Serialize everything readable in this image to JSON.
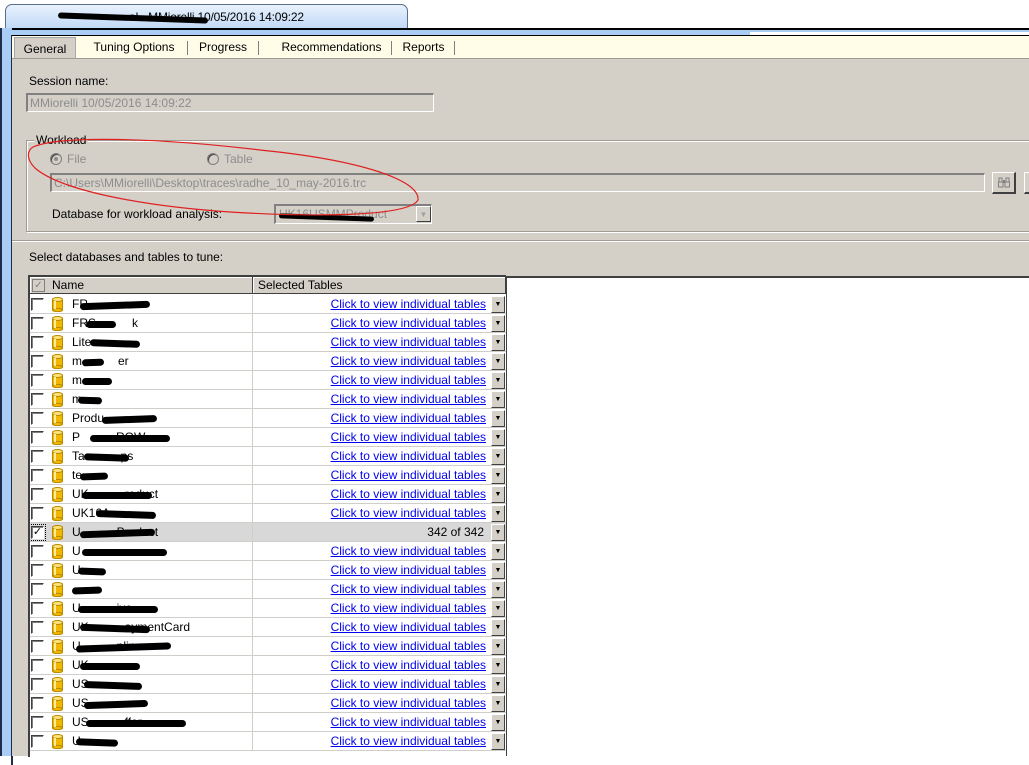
{
  "document_tab": {
    "title_visible": "s...local - MMiorelli 10/05/2016 14:09:22",
    "title_suffix": "al - MMiorelli 10/05/2016 14:09:22"
  },
  "subtabs": [
    {
      "label": "General",
      "active": true
    },
    {
      "label": "Tuning Options",
      "active": false
    },
    {
      "label": "Progress",
      "active": false
    },
    {
      "label": "Recommendations",
      "active": false
    },
    {
      "label": "Reports",
      "active": false
    }
  ],
  "session": {
    "label": "Session name:",
    "value": "MMiorelli 10/05/2016 14:09:22"
  },
  "workload": {
    "group_title": "Workload",
    "radio_file": "File",
    "radio_table": "Table",
    "selected": "File",
    "file_path": "C:\\Users\\MMiorelli\\Desktop\\traces\\radhe_10_may-2016.trc",
    "browse_icon": "binoculars-icon",
    "db_label": "Database for workload analysis:",
    "db_value": "UK16USMMProduct"
  },
  "databases": {
    "label": "Select databases and tables to tune:",
    "columns": [
      "Name",
      "Selected Tables"
    ],
    "link_text": "Click to view individual tables",
    "rows": [
      {
        "name": "FR",
        "checked": false,
        "selected_tables": null
      },
      {
        "name": "FRS...k",
        "checked": false,
        "selected_tables": null
      },
      {
        "name": "Lite",
        "checked": false,
        "selected_tables": null
      },
      {
        "name": "m...er",
        "checked": false,
        "selected_tables": null
      },
      {
        "name": "m",
        "checked": false,
        "selected_tables": null
      },
      {
        "name": "m",
        "checked": false,
        "selected_tables": null
      },
      {
        "name": "Produ",
        "checked": false,
        "selected_tables": null
      },
      {
        "name": "P...ROW",
        "checked": false,
        "selected_tables": null
      },
      {
        "name": "Ta...ps",
        "checked": false,
        "selected_tables": null
      },
      {
        "name": "te",
        "checked": false,
        "selected_tables": null
      },
      {
        "name": "UK...roduct",
        "checked": false,
        "selected_tables": null
      },
      {
        "name": "UK16A",
        "checked": false,
        "selected_tables": null
      },
      {
        "name": "U...Product",
        "checked": true,
        "selected_tables": "342 of 342"
      },
      {
        "name": "U",
        "checked": false,
        "selected_tables": null
      },
      {
        "name": "U",
        "checked": false,
        "selected_tables": null
      },
      {
        "name": "",
        "checked": false,
        "selected_tables": null
      },
      {
        "name": "U...ive",
        "checked": false,
        "selected_tables": null
      },
      {
        "name": "UK...aymentCard",
        "checked": false,
        "selected_tables": null
      },
      {
        "name": "U...nline",
        "checked": false,
        "selected_tables": null
      },
      {
        "name": "UK",
        "checked": false,
        "selected_tables": null
      },
      {
        "name": "US",
        "checked": false,
        "selected_tables": null
      },
      {
        "name": "US",
        "checked": false,
        "selected_tables": null
      },
      {
        "name": "US...ffer",
        "checked": false,
        "selected_tables": null
      },
      {
        "name": "U",
        "checked": false,
        "selected_tables": null
      }
    ]
  },
  "colors": {
    "panel": "#d4d0c8",
    "tab_strip": "#fffde8",
    "link": "#0000ee",
    "annotation": "#e02020",
    "db_icon": "#f2b800"
  }
}
